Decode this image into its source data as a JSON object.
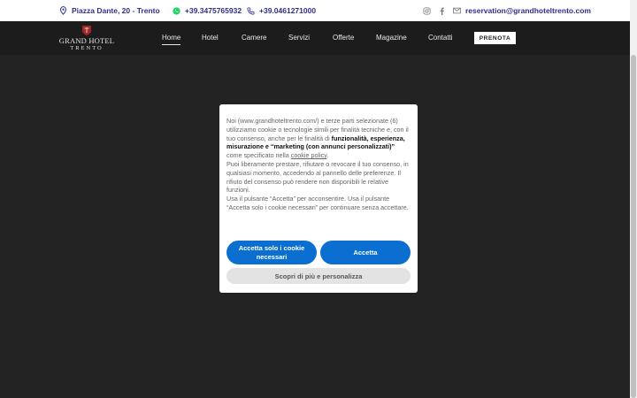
{
  "topbar": {
    "address": "Piazza Dante, 20 - Trento",
    "whatsapp": "+39.3475765932",
    "phone": "+39.0461271000",
    "email": "reservation@grandhoteltrento.com",
    "accent": "#2b2f8f"
  },
  "logo": {
    "line1": "GRAND HOTEL",
    "line2": "TRENTO"
  },
  "nav": {
    "items": [
      "Home",
      "Hotel",
      "Camere",
      "Servizi",
      "Offerte",
      "Magazine",
      "Contatti"
    ],
    "active": "Home",
    "cta": "PRENOTA"
  },
  "cookie": {
    "p1_a": "Noi (www.grandhoteltrento.com/) e terze parti selezionate (6) utilizziamo cookie o tecnologie simili per finalità tecniche e, con il tuo consenso, anche per le finalità di ",
    "p1_bold": "funzionalità, esperienza, misurazione e “marketing (con annunci personalizzati)”",
    "p1_b": " come specificato nella ",
    "policy_link": "cookie policy",
    "p1_c": ".",
    "p2": "Puoi liberamente prestare, rifiutare o revocare il tuo consenso, in qualsiasi momento, accedendo al pannello delle preferenze. Il rifiuto del consenso può rendere non disponibili le relative funzioni.",
    "p3": "Usa il pulsante “Accetta” per acconsentire. Usa il pulsante “Accetta solo i cookie necessari” per continuare senza accettare.",
    "btn_necessary": "Accetta solo i cookie necessari",
    "btn_accept": "Accetta",
    "btn_more": "Scopri di più e personalizza",
    "button_color": "#0a6fd0"
  }
}
